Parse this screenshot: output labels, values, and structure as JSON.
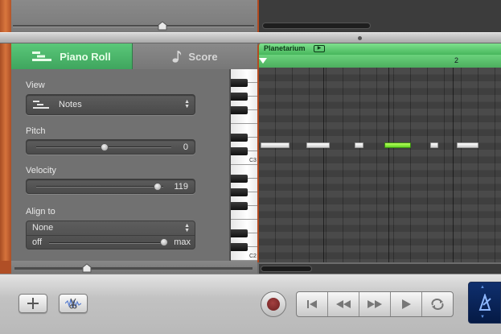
{
  "tabs": {
    "piano_roll": "Piano Roll",
    "score": "Score"
  },
  "inspector": {
    "view": {
      "label": "View",
      "value": "Notes"
    },
    "pitch": {
      "label": "Pitch",
      "value": "0",
      "level": 0.5
    },
    "velocity": {
      "label": "Velocity",
      "value": "119",
      "level": 0.94
    },
    "align": {
      "label": "Align to",
      "value": "None",
      "min_label": "off",
      "max_label": "max",
      "level": 1.0
    }
  },
  "keyboard": {
    "octave_labels": [
      "C3",
      "C2"
    ]
  },
  "region": {
    "name": "Planetarium",
    "bar_marker": "2"
  },
  "notes": [
    {
      "start": 0.0,
      "length": 0.12,
      "selected": false
    },
    {
      "start": 0.19,
      "length": 0.095,
      "selected": false
    },
    {
      "start": 0.39,
      "length": 0.035,
      "selected": false
    },
    {
      "start": 0.51,
      "length": 0.11,
      "selected": true
    },
    {
      "start": 0.7,
      "length": 0.035,
      "selected": false
    },
    {
      "start": 0.81,
      "length": 0.09,
      "selected": false
    }
  ],
  "colors": {
    "accent_green": "#4fbf68",
    "selected_note": "#7de83a",
    "record_red": "#8b2d2d",
    "wood": "#c9652f"
  },
  "icons": {
    "add": "plus-icon",
    "edit": "scissors-wave-icon",
    "tuner": "tuning-fork-icon"
  }
}
